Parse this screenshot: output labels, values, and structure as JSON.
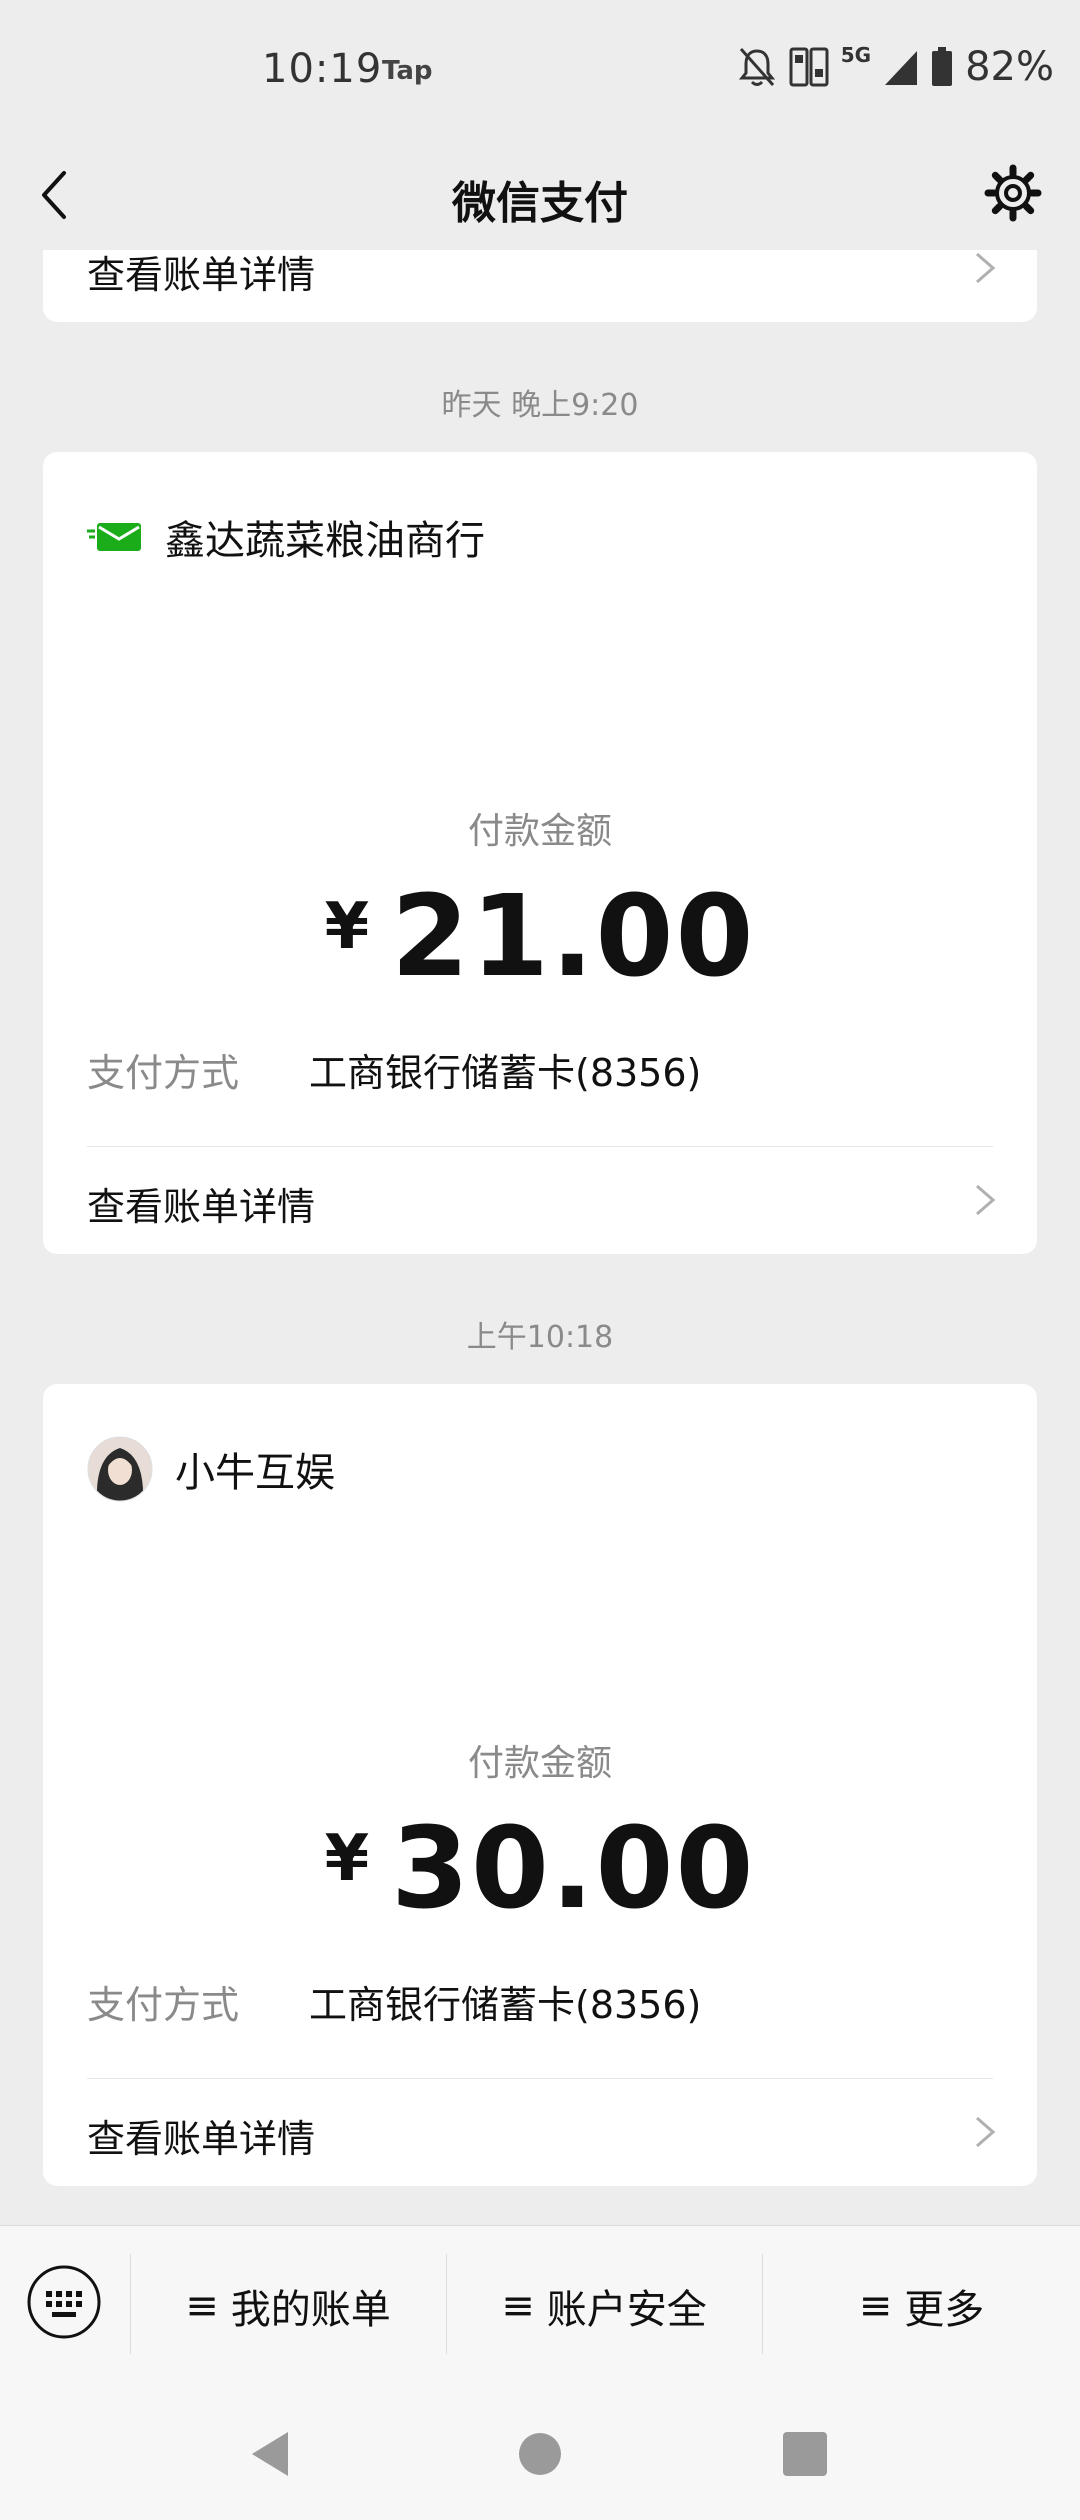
{
  "status_bar": {
    "time": "10:19",
    "app_tag": "Tap",
    "network": "5G",
    "battery": "82%"
  },
  "nav": {
    "title": "微信支付"
  },
  "top_card": {
    "detail_label": "查看账单详情"
  },
  "transactions": [
    {
      "timestamp": "昨天 晚上9:20",
      "merchant": "鑫达蔬菜粮油商行",
      "amount_label": "付款金额",
      "currency": "¥",
      "amount": "21.00",
      "pay_method_label": "支付方式",
      "pay_method": "工商银行储蓄卡(8356)",
      "detail_label": "查看账单详情"
    },
    {
      "timestamp": "上午10:18",
      "merchant": "小牛互娱",
      "amount_label": "付款金额",
      "currency": "¥",
      "amount": "30.00",
      "pay_method_label": "支付方式",
      "pay_method": "工商银行储蓄卡(8356)",
      "detail_label": "查看账单详情"
    }
  ],
  "bottom_menu": {
    "items": [
      {
        "label": "我的账单"
      },
      {
        "label": "账户安全"
      },
      {
        "label": "更多"
      }
    ],
    "lines_glyph": "≡"
  },
  "colors": {
    "background": "#ededed",
    "card": "#ffffff",
    "wechat_green": "#1aad19",
    "secondary_text": "#8a8a8a"
  }
}
